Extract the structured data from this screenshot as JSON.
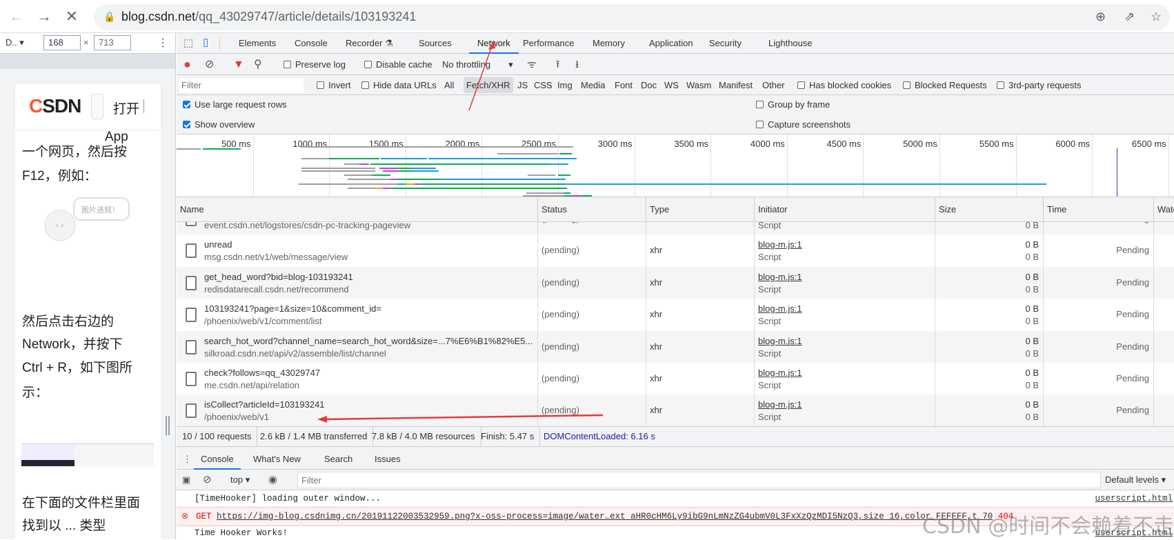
{
  "browser": {
    "url_host": "blog.csdn.net",
    "url_path": "/qq_43029747/article/details/103193241",
    "back_icon": "arrow-left",
    "forward_icon": "arrow-right",
    "stop_icon": "close",
    "icons": [
      "zoom-icon",
      "share-icon",
      "star-icon"
    ]
  },
  "device_toolbar": {
    "device": "D..",
    "width": "168",
    "height": "713",
    "times": "×"
  },
  "page": {
    "logo": "CSDN",
    "open_label": "打开",
    "app_label": "App",
    "lines": [
      "一个网页，然后按",
      "F12，例如：",
      "然后点击右边的",
      "Network，并按下",
      "Ctrl + R，如下图所",
      "示：",
      "在下面的文件栏里面",
      "找到以 ... 类型"
    ],
    "image_placeholder": "图片违规！"
  },
  "devtools": {
    "tabs": [
      "Elements",
      "Console",
      "Recorder",
      "Sources",
      "Network",
      "Performance",
      "Memory",
      "Application",
      "Security",
      "Lighthouse"
    ],
    "active_tab": "Network",
    "toolbar": {
      "preserve_log": "Preserve log",
      "disable_cache": "Disable cache",
      "throttling": "No throttling"
    },
    "filter": {
      "placeholder": "Filter",
      "invert": "Invert",
      "hide_data_urls": "Hide data URLs",
      "types": [
        "All",
        "Fetch/XHR",
        "JS",
        "CSS",
        "Img",
        "Media",
        "Font",
        "Doc",
        "WS",
        "Wasm",
        "Manifest",
        "Other"
      ],
      "selected_type": "Fetch/XHR",
      "has_blocked_cookies": "Has blocked cookies",
      "blocked_requests": "Blocked Requests",
      "third_party": "3rd-party requests"
    },
    "settings": {
      "large_rows": "Use large request rows",
      "large_rows_checked": true,
      "show_overview": "Show overview",
      "show_overview_checked": true,
      "group_by_frame": "Group by frame",
      "capture_screenshots": "Capture screenshots"
    },
    "overview": {
      "ticks": [
        "500 ms",
        "1000 ms",
        "1500 ms",
        "2000 ms",
        "2500 ms",
        "3000 ms",
        "3500 ms",
        "4000 ms",
        "4500 ms",
        "5000 ms",
        "5500 ms",
        "6000 ms",
        "6500 ms"
      ],
      "colors": {
        "gray": "#9e9e9e",
        "green": "#0cab4e",
        "blue": "#1a9be8",
        "purple": "#c23ee0",
        "orange": "#f29c1f",
        "teal": "#1aa5a0"
      },
      "dom_content_loaded_ms": 6160,
      "lanes": [
        [
          [
            "gray",
            0,
            160
          ],
          [
            "green",
            170,
            400
          ],
          [
            "blue",
            400,
            420
          ]
        ],
        [
          [
            "gray",
            815,
            2600
          ]
        ],
        [
          [
            "gray",
            2100,
            2500
          ],
          [
            "green",
            2510,
            2590
          ]
        ],
        [
          [
            "gray",
            820,
            1000
          ],
          [
            "green",
            1000,
            1330
          ],
          [
            "blue",
            1340,
            1640
          ],
          [
            "blue",
            1650,
            2620
          ]
        ],
        [
          [
            "gray",
            1100,
            1200
          ],
          [
            "purple",
            1200,
            1260
          ],
          [
            "green",
            1270,
            2440
          ],
          [
            "blue",
            2440,
            2570
          ]
        ],
        [
          [
            "gray",
            820,
            1300
          ],
          [
            "purple",
            1330,
            1440
          ],
          [
            "green",
            1440,
            1530
          ],
          [
            "blue",
            1530,
            1700
          ]
        ],
        [
          [
            "gray",
            820,
            1300
          ],
          [
            "purple",
            1350,
            1460
          ],
          [
            "green",
            1460,
            1550
          ],
          [
            "blue",
            1550,
            1720
          ]
        ],
        [
          [
            "gray",
            1100,
            1280
          ],
          [
            "green",
            1280,
            1400
          ],
          [
            "gray",
            2300,
            2480
          ],
          [
            "green",
            2500,
            2580
          ]
        ],
        [
          [
            "gray",
            1120,
            1400
          ],
          [
            "purple",
            1400,
            1450
          ],
          [
            "green",
            1450,
            1720
          ],
          [
            "blue",
            1720,
            2550
          ]
        ],
        [
          [
            "gray",
            800,
            1450
          ],
          [
            "teal",
            1450,
            1500
          ],
          [
            "orange",
            1500,
            1560
          ],
          [
            "purple",
            1560,
            1600
          ],
          [
            "green",
            1600,
            2540
          ],
          [
            "blue",
            2540,
            5700
          ]
        ],
        [
          [
            "gray",
            1120,
            1300
          ],
          [
            "orange",
            1300,
            1350
          ],
          [
            "purple",
            1350,
            1400
          ],
          [
            "green",
            1400,
            2560
          ]
        ],
        [
          [
            "gray",
            2290,
            2540
          ],
          [
            "green",
            2540,
            2580
          ]
        ],
        [
          [
            "gray",
            2270,
            2540
          ],
          [
            "teal",
            2540,
            2580
          ],
          [
            "purple",
            2580,
            2650
          ],
          [
            "green",
            2650,
            2720
          ]
        ],
        [
          [
            "gray",
            2270,
            2540
          ],
          [
            "teal",
            2540,
            2580
          ],
          [
            "green",
            2600,
            2680
          ]
        ]
      ]
    },
    "columns": [
      "Name",
      "Status",
      "Type",
      "Initiator",
      "Size",
      "Time",
      "Wate"
    ],
    "rows": [
      {
        "name": "",
        "path": "event.csdn.net/logstores/csdn-pc-tracking-pageview",
        "status": "(pending)",
        "type": "xhr",
        "initiator": "",
        "initiator_type": "Script",
        "size": "0 B",
        "size2": "0 B",
        "time": "Pending"
      },
      {
        "name": "unread",
        "path": "msg.csdn.net/v1/web/message/view",
        "status": "(pending)",
        "type": "xhr",
        "initiator": "blog-m.js:1",
        "initiator_type": "Script",
        "size": "0 B",
        "size2": "0 B",
        "time": "Pending"
      },
      {
        "name": "get_head_word?bid=blog-103193241",
        "path": "redisdatarecall.csdn.net/recommend",
        "status": "(pending)",
        "type": "xhr",
        "initiator": "blog-m.js:1",
        "initiator_type": "Script",
        "size": "0 B",
        "size2": "0 B",
        "time": "Pending"
      },
      {
        "name": "103193241?page=1&size=10&comment_id=",
        "path": "/phoenix/web/v1/comment/list",
        "status": "(pending)",
        "type": "xhr",
        "initiator": "blog-m.js:1",
        "initiator_type": "Script",
        "size": "0 B",
        "size2": "0 B",
        "time": "Pending"
      },
      {
        "name": "search_hot_word?channel_name=search_hot_word&size=...7%E6%B1%82%E5...",
        "path": "silkroad.csdn.net/api/v2/assemble/list/channel",
        "status": "(pending)",
        "type": "xhr",
        "initiator": "blog-m.js:1",
        "initiator_type": "Script",
        "size": "0 B",
        "size2": "0 B",
        "time": "Pending"
      },
      {
        "name": "check?follows=qq_43029747",
        "path": "me.csdn.net/api/relation",
        "status": "(pending)",
        "type": "xhr",
        "initiator": "blog-m.js:1",
        "initiator_type": "Script",
        "size": "0 B",
        "size2": "0 B",
        "time": "Pending"
      },
      {
        "name": "isCollect?articleId=103193241",
        "path": "/phoenix/web/v1",
        "status": "(pending)",
        "type": "xhr",
        "initiator": "blog-m.js:1",
        "initiator_type": "Script",
        "size": "0 B",
        "size2": "0 B",
        "time": "Pending"
      }
    ],
    "summary": {
      "requests": "10 / 100 requests",
      "transferred": "2.6 kB / 1.4 MB transferred",
      "resources": "7.8 kB / 4.0 MB resources",
      "finish": "Finish: 5.47 s",
      "dcl": "DOMContentLoaded: 6.16 s",
      "dcl_color": "#1a1aa6"
    },
    "drawer_tabs": [
      "Console",
      "What's New",
      "Search",
      "Issues"
    ],
    "console": {
      "context": "top",
      "filter_placeholder": "Filter",
      "levels": "Default levels",
      "lines": [
        {
          "text": "[TimeHooker] loading outer window...",
          "source": "userscript.html"
        },
        {
          "method": "GET",
          "url": "https://img-blog.csdnimg.cn/20191122003532959.png?x-oss-process=image/water…ext_aHR0cHM6Ly9ibG9nLmNzZG4ubmV0L3FxXzQzMDI5NzQ3,size_16,color_FFFFFF,t_70",
          "code": "404"
        },
        {
          "text": "Time Hooker Works!",
          "source": "userscript.html"
        }
      ]
    }
  },
  "watermark": "CSDN @时间不会赖着不走",
  "annotation_color": "#e83a3a"
}
